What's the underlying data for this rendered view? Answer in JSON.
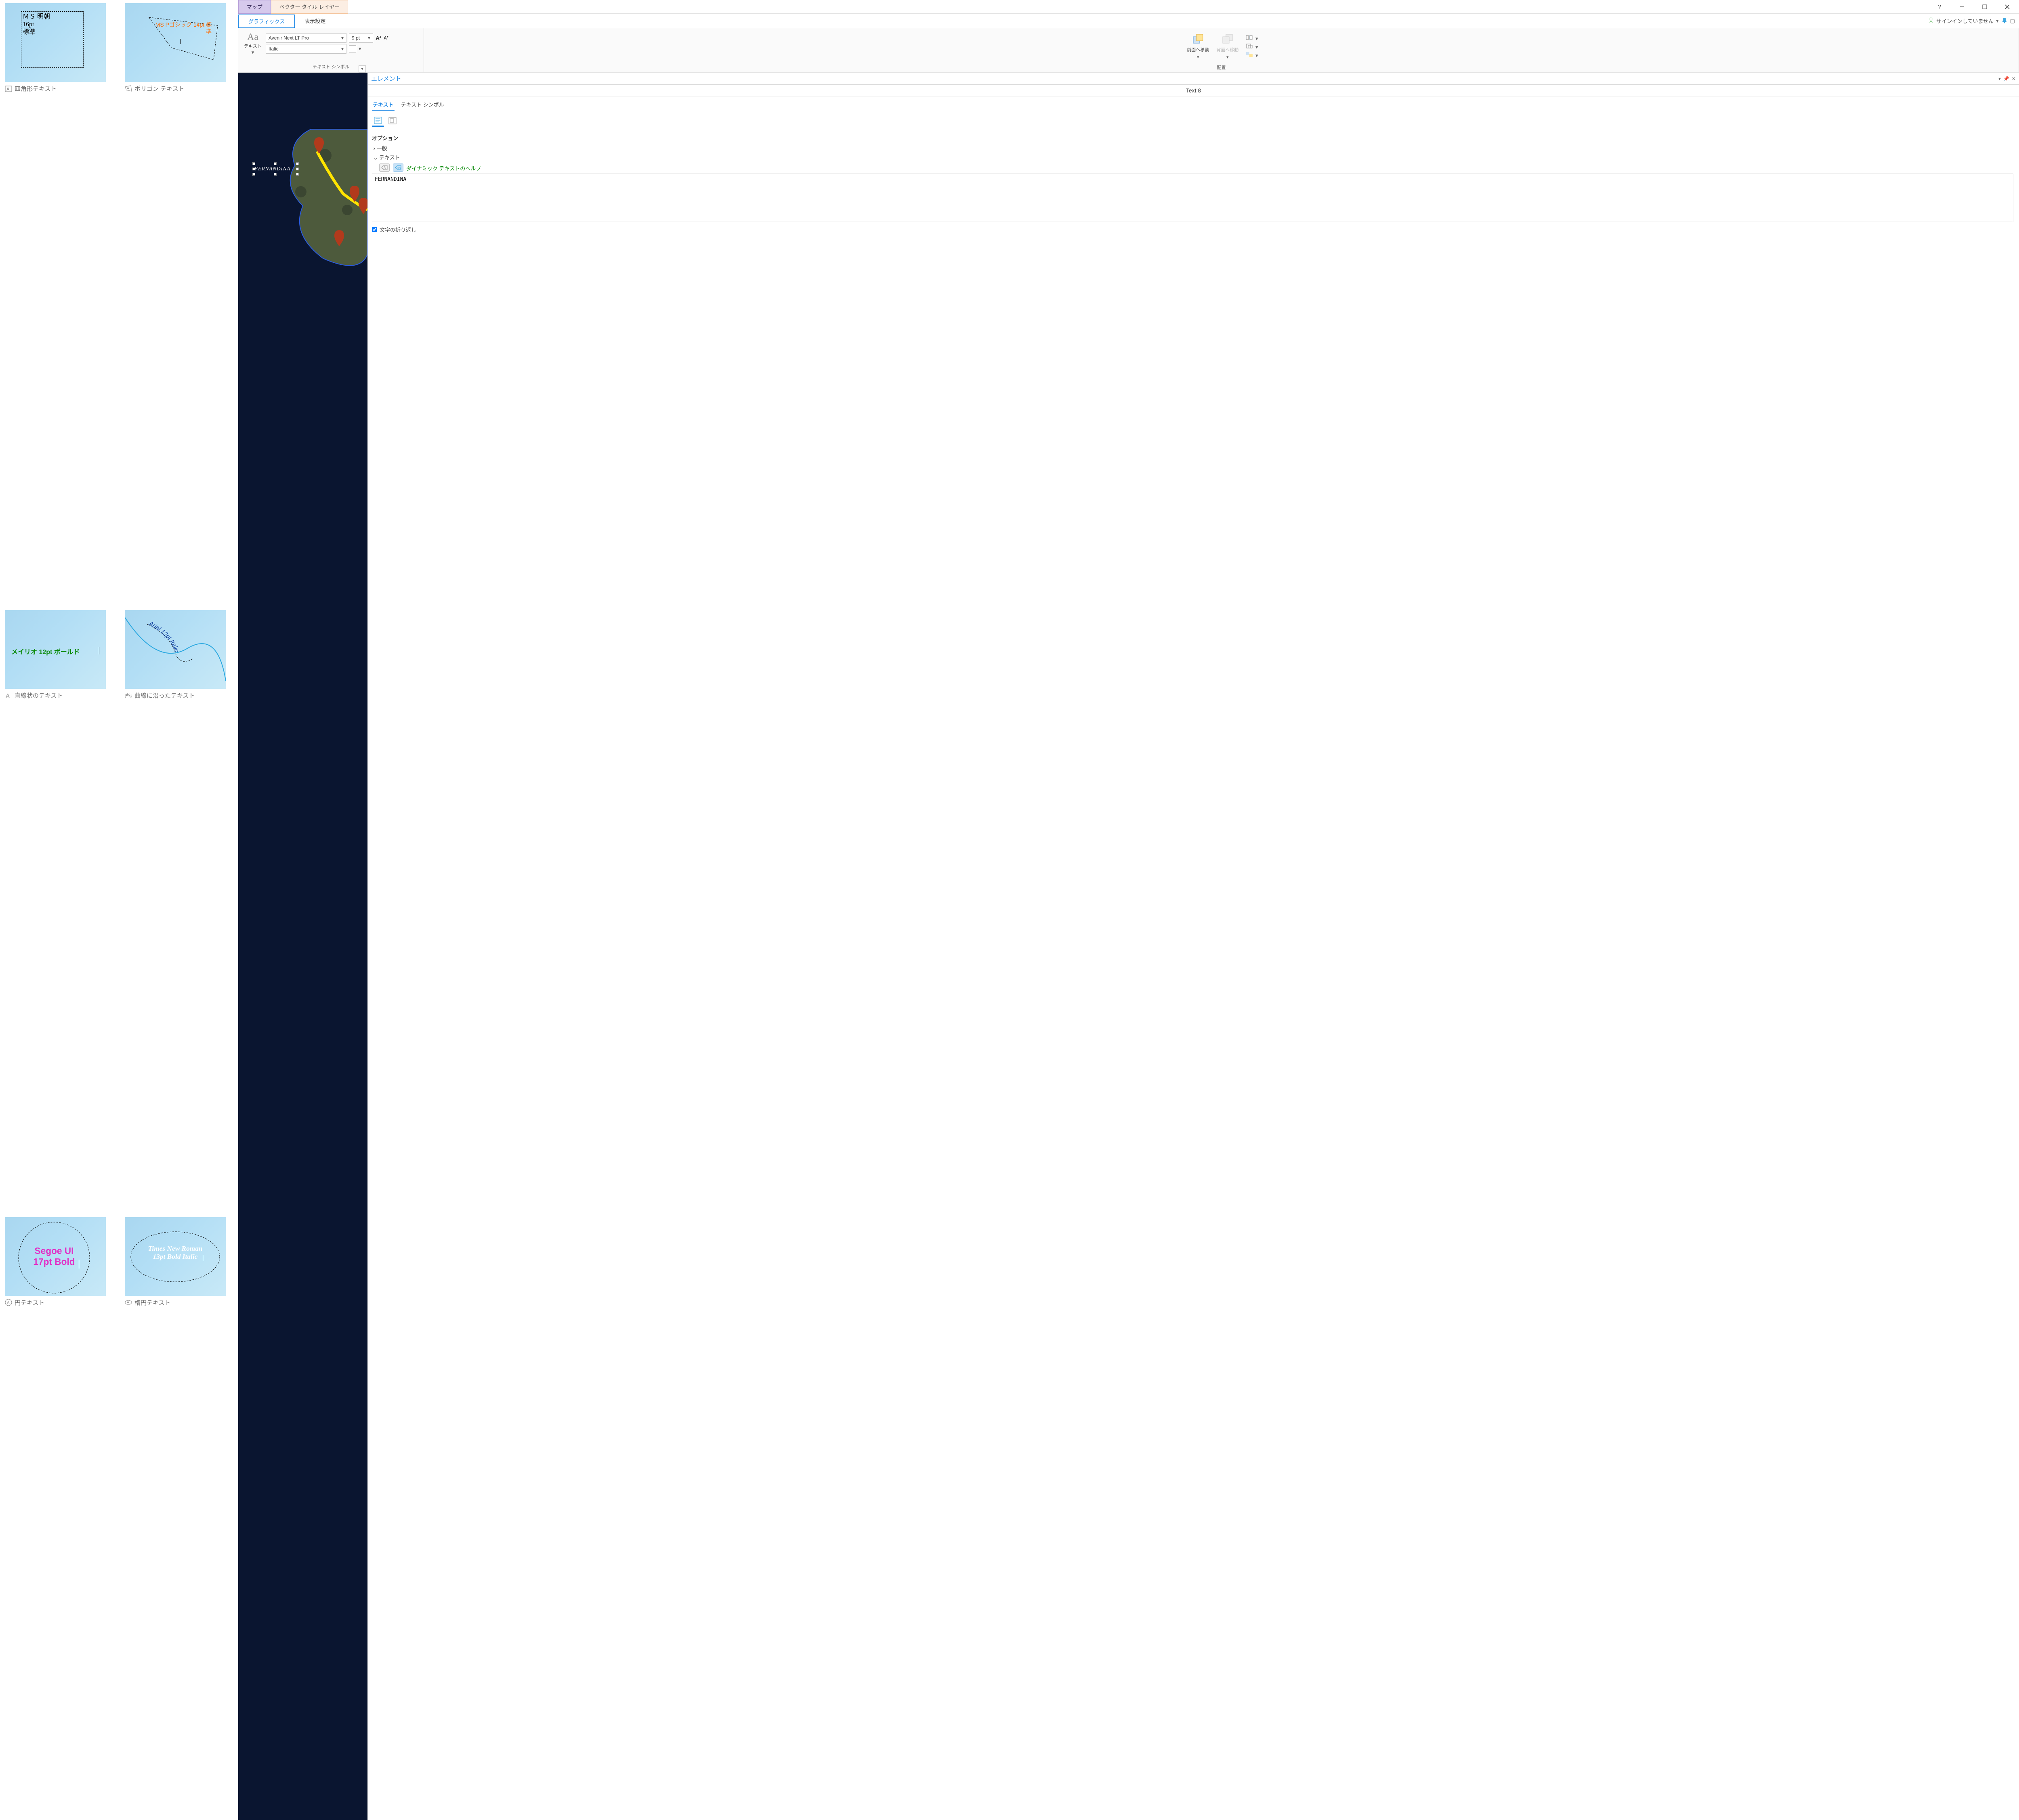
{
  "gallery": {
    "rect": {
      "caption": "四角形テキスト",
      "text": "ＭＳ 明朝\n16pt\n標準"
    },
    "polygon": {
      "caption": "ポリゴン テキスト",
      "text": "MS Pゴシック 14pt 標準"
    },
    "straight": {
      "caption": "直線状のテキスト",
      "text": "メイリオ 12pt ボールド"
    },
    "curve": {
      "caption": "曲線に沿ったテキスト",
      "text": "Arial 12pt Italic"
    },
    "circle": {
      "caption": "円テキスト",
      "text": "Segoe UI 17pt Bold"
    },
    "ellipse": {
      "caption": "楕円テキスト",
      "text": "Times New Roman 13pt Bold Italic"
    }
  },
  "app": {
    "tabs": {
      "map": "マップ",
      "vector": "ベクター タイル レイヤー"
    },
    "subtabs": {
      "graphics": "グラフィックス",
      "display": "表示設定"
    },
    "signin": "サインインしていません",
    "ribbon": {
      "text": "テキスト",
      "font_family": "Avenir Next LT Pro",
      "font_style": "Italic",
      "font_size": "9 pt",
      "group_textsymbol": "テキスト シンボル",
      "bring_forward": "前面へ移動",
      "send_backward": "背面へ移動",
      "group_arrange": "配置"
    },
    "map_label": "FERNANDINA",
    "panel": {
      "title": "エレメント",
      "subtitle": "Text 8",
      "tab_text": "テキスト",
      "tab_symbol": "テキスト シンボル",
      "section_options": "オプション",
      "row_general": "一般",
      "row_text": "テキスト",
      "help": "ダイナミック テキストのヘルプ",
      "text_value": "FERNANDINA",
      "wrap": "文字の折り返し"
    }
  }
}
